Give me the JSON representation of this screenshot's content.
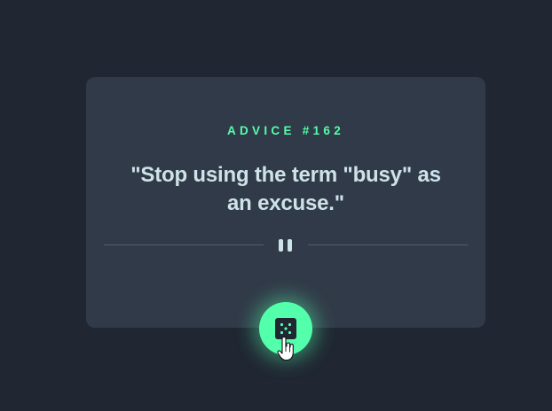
{
  "card": {
    "advice_id": "ADVICE #162",
    "advice_text": "\"Stop using the term \"busy\" as an excuse.\""
  },
  "divider": {
    "icon": "pause-icon"
  },
  "dice_button": {
    "icon": "dice-icon"
  },
  "colors": {
    "background": "#202632",
    "card": "#313a48",
    "accent": "#53ffaa",
    "text": "#cee3e9",
    "divider": "#4f5d74"
  }
}
